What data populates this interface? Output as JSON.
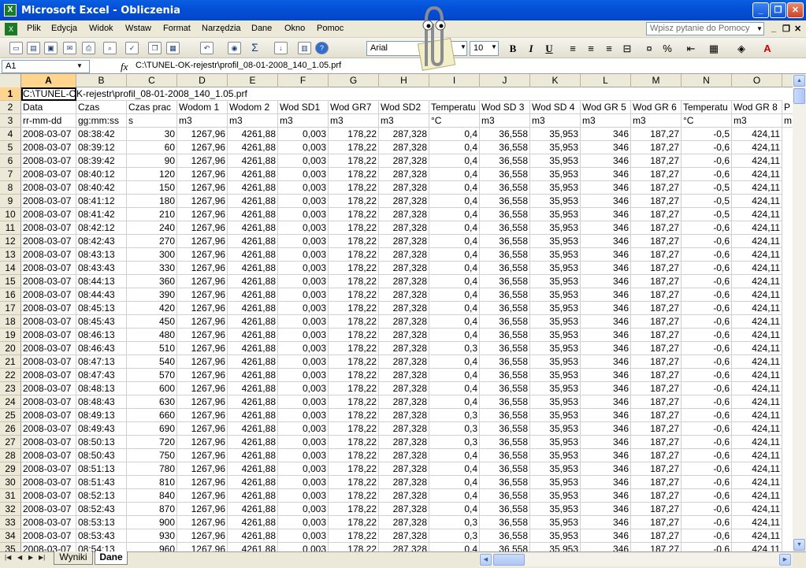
{
  "window": {
    "title": "Microsoft Excel - Obliczenia",
    "app_icon": "excel-icon"
  },
  "menu": [
    "Plik",
    "Edycja",
    "Widok",
    "Wstaw",
    "Format",
    "Narzędzia",
    "Dane",
    "Okno",
    "Pomoc"
  ],
  "help_box": {
    "placeholder": "Wpisz pytanie do Pomocy"
  },
  "toolbar": {
    "font": "Arial",
    "size": "10",
    "bold": "B",
    "italic": "I",
    "underline": "U",
    "percent": "%"
  },
  "formula_bar": {
    "name_box": "A1",
    "fx": "fx",
    "formula": "C:\\TUNEL-OK-rejestr\\profil_08-01-2008_140_1.05.prf"
  },
  "columns": [
    "A",
    "B",
    "C",
    "D",
    "E",
    "F",
    "G",
    "H",
    "I",
    "J",
    "K",
    "L",
    "M",
    "N",
    "O"
  ],
  "row1_text": "C:\\TUNEL-OK-rejestr\\profil_08-01-2008_140_1.05.prf",
  "row2_headers": [
    "Data",
    "Czas",
    "Czas prac",
    "Wodom 1",
    "Wodom 2",
    "Wod SD1",
    "Wod GR7",
    "Wod SD2",
    "Temperatu",
    "Wod SD 3",
    "Wod SD 4",
    "Wod GR 5",
    "Wod GR 6",
    "Temperatu",
    "Wod GR 8",
    "P"
  ],
  "row3_units": [
    "rr-mm-dd",
    "gg:mm:ss",
    "s",
    "m3",
    "m3",
    "m3",
    "m3",
    "m3",
    "°C",
    "m3",
    "m3",
    "m3",
    "m3",
    "°C",
    "m3",
    "m"
  ],
  "data_rows": [
    [
      "4",
      "2008-03-07",
      "08:38:42",
      "30",
      "1267,96",
      "4261,88",
      "0,003",
      "178,22",
      "287,328",
      "0,4",
      "36,558",
      "35,953",
      "346",
      "187,27",
      "-0,5",
      "424,11"
    ],
    [
      "5",
      "2008-03-07",
      "08:39:12",
      "60",
      "1267,96",
      "4261,88",
      "0,003",
      "178,22",
      "287,328",
      "0,4",
      "36,558",
      "35,953",
      "346",
      "187,27",
      "-0,6",
      "424,11"
    ],
    [
      "6",
      "2008-03-07",
      "08:39:42",
      "90",
      "1267,96",
      "4261,88",
      "0,003",
      "178,22",
      "287,328",
      "0,4",
      "36,558",
      "35,953",
      "346",
      "187,27",
      "-0,6",
      "424,11"
    ],
    [
      "7",
      "2008-03-07",
      "08:40:12",
      "120",
      "1267,96",
      "4261,88",
      "0,003",
      "178,22",
      "287,328",
      "0,4",
      "36,558",
      "35,953",
      "346",
      "187,27",
      "-0,6",
      "424,11"
    ],
    [
      "8",
      "2008-03-07",
      "08:40:42",
      "150",
      "1267,96",
      "4261,88",
      "0,003",
      "178,22",
      "287,328",
      "0,4",
      "36,558",
      "35,953",
      "346",
      "187,27",
      "-0,5",
      "424,11"
    ],
    [
      "9",
      "2008-03-07",
      "08:41:12",
      "180",
      "1267,96",
      "4261,88",
      "0,003",
      "178,22",
      "287,328",
      "0,4",
      "36,558",
      "35,953",
      "346",
      "187,27",
      "-0,5",
      "424,11"
    ],
    [
      "10",
      "2008-03-07",
      "08:41:42",
      "210",
      "1267,96",
      "4261,88",
      "0,003",
      "178,22",
      "287,328",
      "0,4",
      "36,558",
      "35,953",
      "346",
      "187,27",
      "-0,5",
      "424,11"
    ],
    [
      "11",
      "2008-03-07",
      "08:42:12",
      "240",
      "1267,96",
      "4261,88",
      "0,003",
      "178,22",
      "287,328",
      "0,4",
      "36,558",
      "35,953",
      "346",
      "187,27",
      "-0,6",
      "424,11"
    ],
    [
      "12",
      "2008-03-07",
      "08:42:43",
      "270",
      "1267,96",
      "4261,88",
      "0,003",
      "178,22",
      "287,328",
      "0,4",
      "36,558",
      "35,953",
      "346",
      "187,27",
      "-0,6",
      "424,11"
    ],
    [
      "13",
      "2008-03-07",
      "08:43:13",
      "300",
      "1267,96",
      "4261,88",
      "0,003",
      "178,22",
      "287,328",
      "0,4",
      "36,558",
      "35,953",
      "346",
      "187,27",
      "-0,6",
      "424,11"
    ],
    [
      "14",
      "2008-03-07",
      "08:43:43",
      "330",
      "1267,96",
      "4261,88",
      "0,003",
      "178,22",
      "287,328",
      "0,4",
      "36,558",
      "35,953",
      "346",
      "187,27",
      "-0,6",
      "424,11"
    ],
    [
      "15",
      "2008-03-07",
      "08:44:13",
      "360",
      "1267,96",
      "4261,88",
      "0,003",
      "178,22",
      "287,328",
      "0,4",
      "36,558",
      "35,953",
      "346",
      "187,27",
      "-0,6",
      "424,11"
    ],
    [
      "16",
      "2008-03-07",
      "08:44:43",
      "390",
      "1267,96",
      "4261,88",
      "0,003",
      "178,22",
      "287,328",
      "0,4",
      "36,558",
      "35,953",
      "346",
      "187,27",
      "-0,6",
      "424,11"
    ],
    [
      "17",
      "2008-03-07",
      "08:45:13",
      "420",
      "1267,96",
      "4261,88",
      "0,003",
      "178,22",
      "287,328",
      "0,4",
      "36,558",
      "35,953",
      "346",
      "187,27",
      "-0,6",
      "424,11"
    ],
    [
      "18",
      "2008-03-07",
      "08:45:43",
      "450",
      "1267,96",
      "4261,88",
      "0,003",
      "178,22",
      "287,328",
      "0,4",
      "36,558",
      "35,953",
      "346",
      "187,27",
      "-0,6",
      "424,11"
    ],
    [
      "19",
      "2008-03-07",
      "08:46:13",
      "480",
      "1267,96",
      "4261,88",
      "0,003",
      "178,22",
      "287,328",
      "0,4",
      "36,558",
      "35,953",
      "346",
      "187,27",
      "-0,6",
      "424,11"
    ],
    [
      "20",
      "2008-03-07",
      "08:46:43",
      "510",
      "1267,96",
      "4261,88",
      "0,003",
      "178,22",
      "287,328",
      "0,3",
      "36,558",
      "35,953",
      "346",
      "187,27",
      "-0,6",
      "424,11"
    ],
    [
      "21",
      "2008-03-07",
      "08:47:13",
      "540",
      "1267,96",
      "4261,88",
      "0,003",
      "178,22",
      "287,328",
      "0,4",
      "36,558",
      "35,953",
      "346",
      "187,27",
      "-0,6",
      "424,11"
    ],
    [
      "22",
      "2008-03-07",
      "08:47:43",
      "570",
      "1267,96",
      "4261,88",
      "0,003",
      "178,22",
      "287,328",
      "0,4",
      "36,558",
      "35,953",
      "346",
      "187,27",
      "-0,6",
      "424,11"
    ],
    [
      "23",
      "2008-03-07",
      "08:48:13",
      "600",
      "1267,96",
      "4261,88",
      "0,003",
      "178,22",
      "287,328",
      "0,4",
      "36,558",
      "35,953",
      "346",
      "187,27",
      "-0,6",
      "424,11"
    ],
    [
      "24",
      "2008-03-07",
      "08:48:43",
      "630",
      "1267,96",
      "4261,88",
      "0,003",
      "178,22",
      "287,328",
      "0,4",
      "36,558",
      "35,953",
      "346",
      "187,27",
      "-0,6",
      "424,11"
    ],
    [
      "25",
      "2008-03-07",
      "08:49:13",
      "660",
      "1267,96",
      "4261,88",
      "0,003",
      "178,22",
      "287,328",
      "0,3",
      "36,558",
      "35,953",
      "346",
      "187,27",
      "-0,6",
      "424,11"
    ],
    [
      "26",
      "2008-03-07",
      "08:49:43",
      "690",
      "1267,96",
      "4261,88",
      "0,003",
      "178,22",
      "287,328",
      "0,3",
      "36,558",
      "35,953",
      "346",
      "187,27",
      "-0,6",
      "424,11"
    ],
    [
      "27",
      "2008-03-07",
      "08:50:13",
      "720",
      "1267,96",
      "4261,88",
      "0,003",
      "178,22",
      "287,328",
      "0,3",
      "36,558",
      "35,953",
      "346",
      "187,27",
      "-0,6",
      "424,11"
    ],
    [
      "28",
      "2008-03-07",
      "08:50:43",
      "750",
      "1267,96",
      "4261,88",
      "0,003",
      "178,22",
      "287,328",
      "0,4",
      "36,558",
      "35,953",
      "346",
      "187,27",
      "-0,6",
      "424,11"
    ],
    [
      "29",
      "2008-03-07",
      "08:51:13",
      "780",
      "1267,96",
      "4261,88",
      "0,003",
      "178,22",
      "287,328",
      "0,4",
      "36,558",
      "35,953",
      "346",
      "187,27",
      "-0,6",
      "424,11"
    ],
    [
      "30",
      "2008-03-07",
      "08:51:43",
      "810",
      "1267,96",
      "4261,88",
      "0,003",
      "178,22",
      "287,328",
      "0,4",
      "36,558",
      "35,953",
      "346",
      "187,27",
      "-0,6",
      "424,11"
    ],
    [
      "31",
      "2008-03-07",
      "08:52:13",
      "840",
      "1267,96",
      "4261,88",
      "0,003",
      "178,22",
      "287,328",
      "0,4",
      "36,558",
      "35,953",
      "346",
      "187,27",
      "-0,6",
      "424,11"
    ],
    [
      "32",
      "2008-03-07",
      "08:52:43",
      "870",
      "1267,96",
      "4261,88",
      "0,003",
      "178,22",
      "287,328",
      "0,4",
      "36,558",
      "35,953",
      "346",
      "187,27",
      "-0,6",
      "424,11"
    ],
    [
      "33",
      "2008-03-07",
      "08:53:13",
      "900",
      "1267,96",
      "4261,88",
      "0,003",
      "178,22",
      "287,328",
      "0,3",
      "36,558",
      "35,953",
      "346",
      "187,27",
      "-0,6",
      "424,11"
    ],
    [
      "34",
      "2008-03-07",
      "08:53:43",
      "930",
      "1267,96",
      "4261,88",
      "0,003",
      "178,22",
      "287,328",
      "0,3",
      "36,558",
      "35,953",
      "346",
      "187,27",
      "-0,6",
      "424,11"
    ],
    [
      "35",
      "2008-03-07",
      "08:54:13",
      "960",
      "1267,96",
      "4261,88",
      "0,003",
      "178,22",
      "287,328",
      "0,4",
      "36,558",
      "35,953",
      "346",
      "187,27",
      "-0,6",
      "424,11"
    ]
  ],
  "sheets": [
    "Wyniki",
    "Dane"
  ]
}
